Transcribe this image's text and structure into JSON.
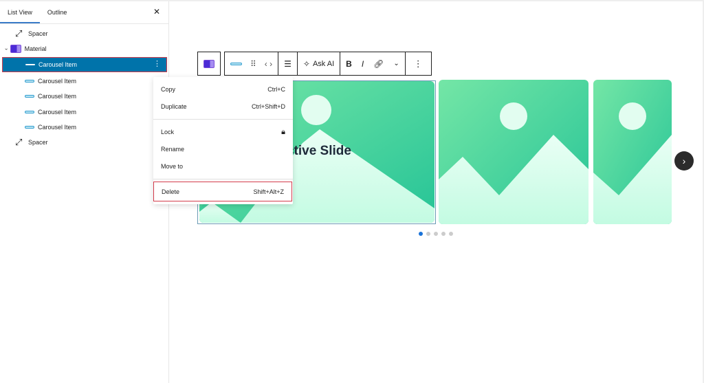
{
  "sidebar": {
    "tabs": [
      {
        "label": "List View"
      },
      {
        "label": "Outline"
      }
    ],
    "close_icon": "close-icon",
    "tree": [
      {
        "label": "Spacer",
        "icon": "spacer-icon"
      },
      {
        "label": "Material",
        "icon": "carousel-block-icon",
        "expanded": true
      },
      {
        "label": "Carousel Item",
        "icon": "carousel-item-icon",
        "selected": true
      },
      {
        "label": "Carousel Item",
        "icon": "carousel-item-icon"
      },
      {
        "label": "Carousel Item",
        "icon": "carousel-item-icon"
      },
      {
        "label": "Carousel Item",
        "icon": "carousel-item-icon"
      },
      {
        "label": "Carousel Item",
        "icon": "carousel-item-icon"
      },
      {
        "label": "Spacer",
        "icon": "spacer-icon"
      }
    ]
  },
  "context_menu": {
    "items": [
      {
        "label": "Copy",
        "shortcut": "Ctrl+C"
      },
      {
        "label": "Duplicate",
        "shortcut": "Ctrl+Shift+D"
      },
      {
        "label": "Lock",
        "shortcut": ""
      },
      {
        "label": "Rename",
        "shortcut": ""
      },
      {
        "label": "Move to",
        "shortcut": ""
      },
      {
        "label": "Delete",
        "shortcut": "Shift+Alt+Z"
      }
    ]
  },
  "toolbar": {
    "ask_ai_label": "Ask AI",
    "bold_label": "B",
    "italic_label": "I"
  },
  "carousel": {
    "slide_title": "ractive Slide",
    "total_slides": 5,
    "active_slide": 1,
    "colors": {
      "accent": "#0073aa",
      "highlight_border": "#d33a4a",
      "slide_green": "#3fd19c",
      "slide_light": "#c8fbe4",
      "dot_active": "#1a73d9"
    }
  }
}
